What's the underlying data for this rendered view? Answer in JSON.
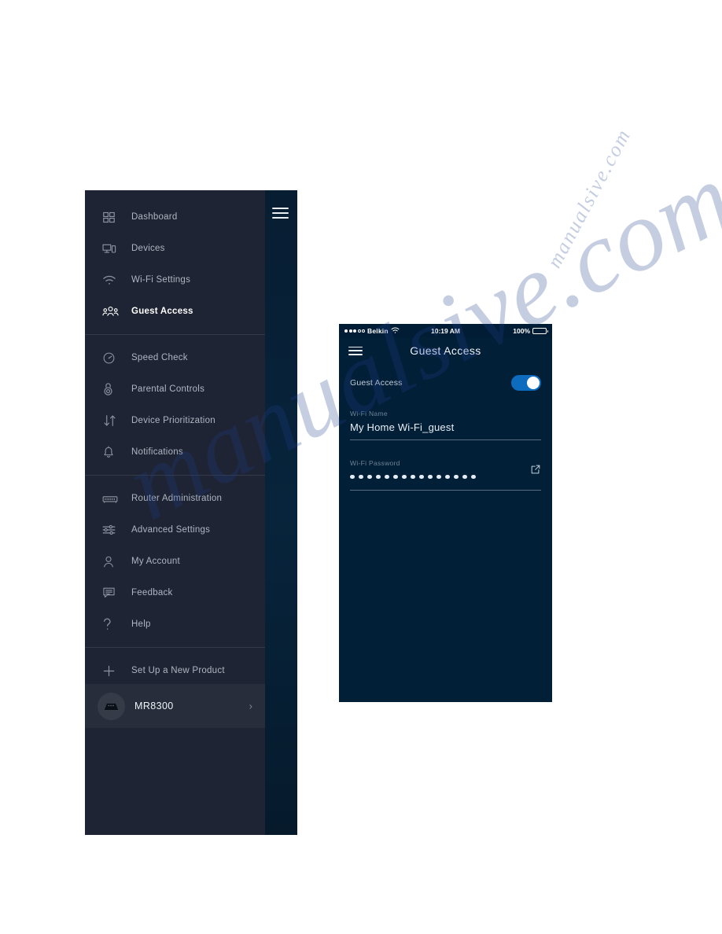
{
  "watermark": {
    "main": "manualsive.com",
    "sub": "manualsive.com"
  },
  "sidebar": {
    "menu_icon": "hamburger-icon",
    "items": [
      {
        "label": "Dashboard",
        "icon": "dashboard-icon",
        "active": false
      },
      {
        "label": "Devices",
        "icon": "devices-icon",
        "active": false
      },
      {
        "label": "Wi-Fi Settings",
        "icon": "wifi-icon",
        "active": false
      },
      {
        "label": "Guest Access",
        "icon": "guest-access-icon",
        "active": true
      },
      {
        "label": "Speed Check",
        "icon": "speedometer-icon",
        "active": false
      },
      {
        "label": "Parental Controls",
        "icon": "lock-icon",
        "active": false
      },
      {
        "label": "Device Prioritization",
        "icon": "up-down-arrows-icon",
        "active": false
      },
      {
        "label": "Notifications",
        "icon": "bell-icon",
        "active": false
      },
      {
        "label": "Router Administration",
        "icon": "router-icon",
        "active": false
      },
      {
        "label": "Advanced Settings",
        "icon": "sliders-icon",
        "active": false
      },
      {
        "label": "My Account",
        "icon": "person-icon",
        "active": false
      },
      {
        "label": "Feedback",
        "icon": "chat-bubble-icon",
        "active": false
      },
      {
        "label": "Help",
        "icon": "question-mark-icon",
        "active": false
      },
      {
        "label": "Set Up a New Product",
        "icon": "plus-icon",
        "active": false
      }
    ],
    "router_card": {
      "name": "MR8300",
      "avatar_icon": "router-device-icon",
      "chevron": "›"
    }
  },
  "phone": {
    "status_bar": {
      "signal_filled_dots": 3,
      "signal_hollow_dots": 2,
      "carrier": "Belkin",
      "wifi_icon": "wifi-icon",
      "time": "10:19 AM",
      "battery_percent": "100%",
      "battery_icon": "battery-full-icon"
    },
    "header": {
      "menu_icon": "hamburger-icon",
      "title": "Guest Access"
    },
    "guest_toggle": {
      "label": "Guest Access",
      "state": "on",
      "on_color": "#0d6cbe",
      "knob_color": "#ffffff"
    },
    "wifi_name": {
      "label": "Wi-Fi Name",
      "value": "My Home Wi-Fi_guest"
    },
    "wifi_password": {
      "label": "Wi-Fi Password",
      "masked_dot_count": 15,
      "share_icon": "external-link-icon"
    }
  },
  "colors": {
    "page_background": "#ffffff",
    "sidebar_background": "#1e2433",
    "sidebar_rail": "#07243c",
    "phone_background": "#021f38",
    "accent_blue": "#0d6cbe",
    "text_primary": "#ffffff",
    "text_muted": "#aeb6c2",
    "label_muted": "#6f8296"
  }
}
